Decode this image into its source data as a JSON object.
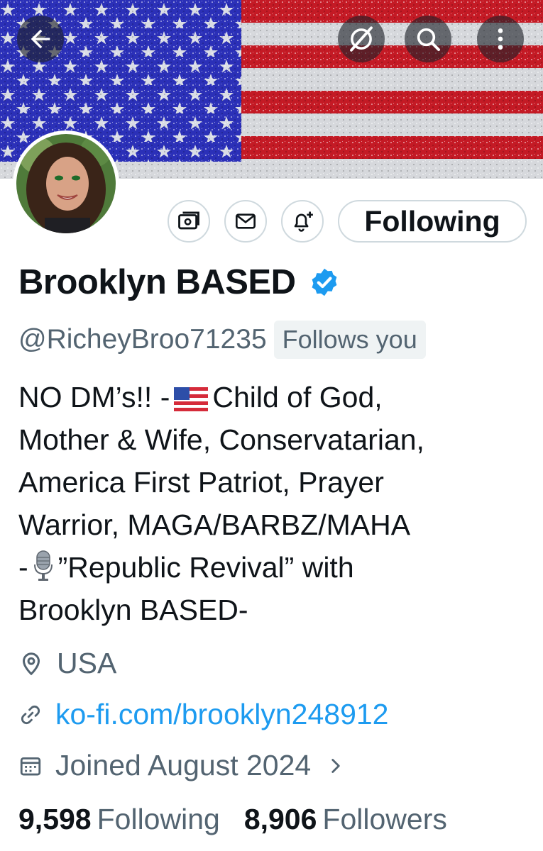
{
  "header": {
    "back_icon": "arrow-left-icon",
    "grok_icon": "grok-icon",
    "search_icon": "search-icon",
    "more_icon": "more-vertical-icon"
  },
  "banner": {
    "description_colors": [
      "#2a2fb5",
      "#c61a26",
      "#d8d8d8"
    ]
  },
  "actions": {
    "subscribe_icon": "subscribe-icon",
    "message_icon": "envelope-icon",
    "notify_icon": "bell-plus-icon",
    "following_label": "Following"
  },
  "profile": {
    "display_name": "Brooklyn BASED",
    "verified": true,
    "handle": "@RicheyBroo71235",
    "follows_you": "Follows you",
    "bio": {
      "line1_a": "NO DM’s!! -",
      "line1_b": "Child of God,",
      "line2": "Mother & Wife, Conservatarian,",
      "line3": "America First Patriot, Prayer",
      "line4": "Warrior, MAGA/BARBZ/MAHA",
      "line5_a": "-",
      "line5_b": "”Republic Revival” with",
      "line6": "Brooklyn BASED-"
    },
    "location": "USA",
    "website": "ko-fi.com/brooklyn248912",
    "joined": "Joined August 2024"
  },
  "stats": {
    "following_count": "9,598",
    "following_label": "Following",
    "followers_count": "8,906",
    "followers_label": "Followers"
  },
  "colors": {
    "accent": "#1d9bf0",
    "secondary_text": "#536471",
    "primary_text": "#0f1419"
  }
}
